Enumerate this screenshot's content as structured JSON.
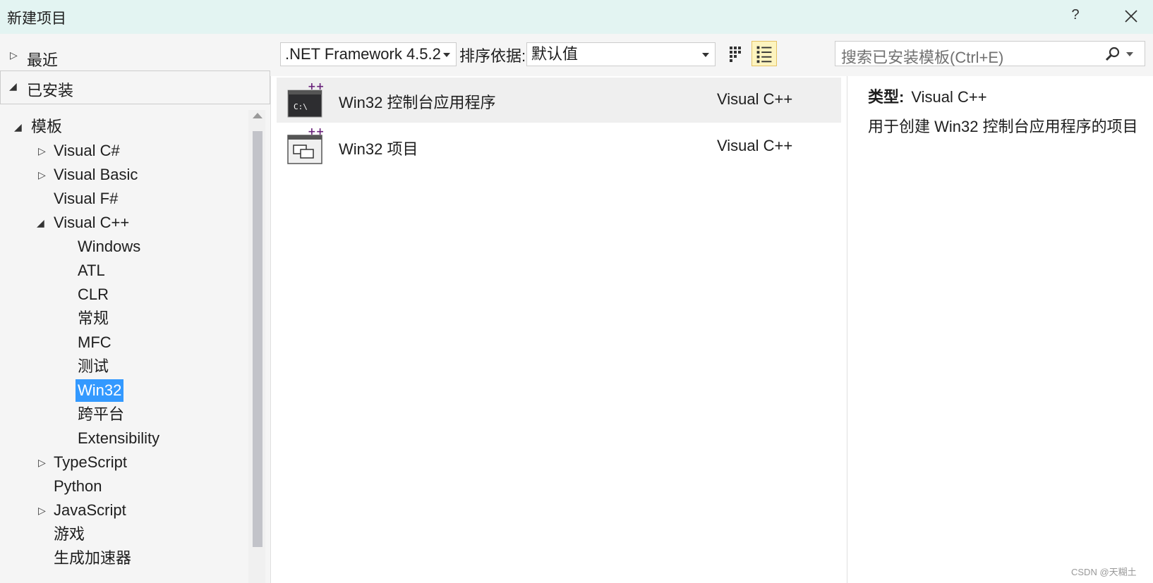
{
  "window": {
    "title": "新建项目",
    "help_label": "?"
  },
  "left": {
    "recent_label": "最近",
    "installed_label": "已安装",
    "tree": [
      {
        "label": "模板",
        "expanded": true
      },
      {
        "label": "Visual C#"
      },
      {
        "label": "Visual Basic"
      },
      {
        "label": "Visual F#"
      },
      {
        "label": "Visual C++",
        "expanded": true
      },
      {
        "label": "Windows"
      },
      {
        "label": "ATL"
      },
      {
        "label": "CLR"
      },
      {
        "label": "常规"
      },
      {
        "label": "MFC"
      },
      {
        "label": "测试"
      },
      {
        "label": "Win32",
        "selected": true
      },
      {
        "label": "跨平台"
      },
      {
        "label": "Extensibility"
      },
      {
        "label": "TypeScript"
      },
      {
        "label": "Python"
      },
      {
        "label": "JavaScript"
      },
      {
        "label": "游戏"
      },
      {
        "label": "生成加速器"
      }
    ]
  },
  "toolbar": {
    "framework_value": ".NET Framework 4.5.2",
    "sort_label": "排序依据:",
    "sort_value": "默认值",
    "search_placeholder": "搜索已安装模板(Ctrl+E)"
  },
  "templates": [
    {
      "name": "Win32 控制台应用程序",
      "lang": "Visual C++",
      "icon": "console-app-icon"
    },
    {
      "name": "Win32 项目",
      "lang": "Visual C++",
      "icon": "win32-project-icon"
    }
  ],
  "details": {
    "type_label": "类型:",
    "type_value": "Visual C++",
    "description": "用于创建 Win32 控制台应用程序的项目"
  },
  "watermark": "CSDN @天糊土",
  "colors": {
    "titlebar": "#e3f4f2",
    "selection": "#3399ff",
    "panel": "#f5f5f5",
    "active_view_btn": "#fdf4bf"
  }
}
